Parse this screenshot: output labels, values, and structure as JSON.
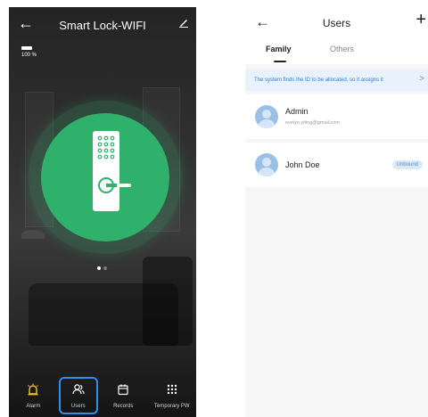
{
  "left_screen": {
    "title": "Smart Lock-WIFI",
    "battery_percent": "100 %",
    "battery_level": 1.0,
    "accent_color": "#2fb06b",
    "icons": {
      "back": "back-arrow-icon",
      "edit": "edit-pencil-icon",
      "lock": "door-lock-keypad-icon"
    },
    "pager": {
      "pages": 2,
      "active": 1
    },
    "nav": [
      {
        "label": "Alarm",
        "icon": "alarm-icon",
        "icon_color": "#f5c518"
      },
      {
        "label": "Users",
        "icon": "users-icon",
        "selected": true
      },
      {
        "label": "Records",
        "icon": "calendar-icon"
      },
      {
        "label": "Temporary PW",
        "icon": "keypad-grid-icon"
      }
    ],
    "selection_color": "#2f8fe6"
  },
  "right_screen": {
    "title": "Users",
    "back_icon": "back-arrow-icon",
    "add_icon": "plus-icon",
    "add_label": "+",
    "tabs": [
      {
        "label": "Family",
        "active": true
      },
      {
        "label": "Others",
        "active": false
      }
    ],
    "notice": {
      "text": "The system finds the ID to be allocated, so it assigns it",
      "chevron": ">"
    },
    "users": [
      {
        "name": "Admin",
        "email": "evelyn.yiting@gmail.com",
        "avatar_icon": "user-avatar-icon"
      },
      {
        "name": "John Doe",
        "status": "Unbound",
        "avatar_icon": "user-avatar-icon"
      }
    ],
    "link_color": "#2f7fd6"
  }
}
